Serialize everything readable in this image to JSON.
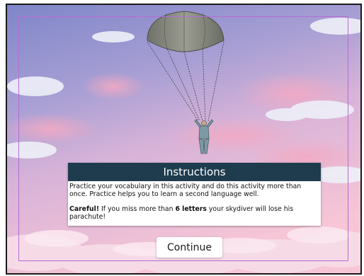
{
  "instructions": {
    "title": "Instructions",
    "paragraph1": "Practice your vocabulary in this activity and do this activity more than once. Practice helps you to learn a second language well.",
    "warning_label": "Careful!",
    "warning_prefix": " If you miss more than ",
    "warning_highlight": "6 letters",
    "warning_suffix": " your skydiver will lose his parachute!"
  },
  "continue_button": {
    "label": "Continue"
  },
  "colors": {
    "header_background": "#1f3c4f",
    "inner_border": "#b86ad6",
    "sky_top": "#7f86c9",
    "sky_bottom": "#f6c5d6"
  },
  "icons": {
    "character": "skydiver-icon",
    "canopy": "parachute-icon"
  }
}
